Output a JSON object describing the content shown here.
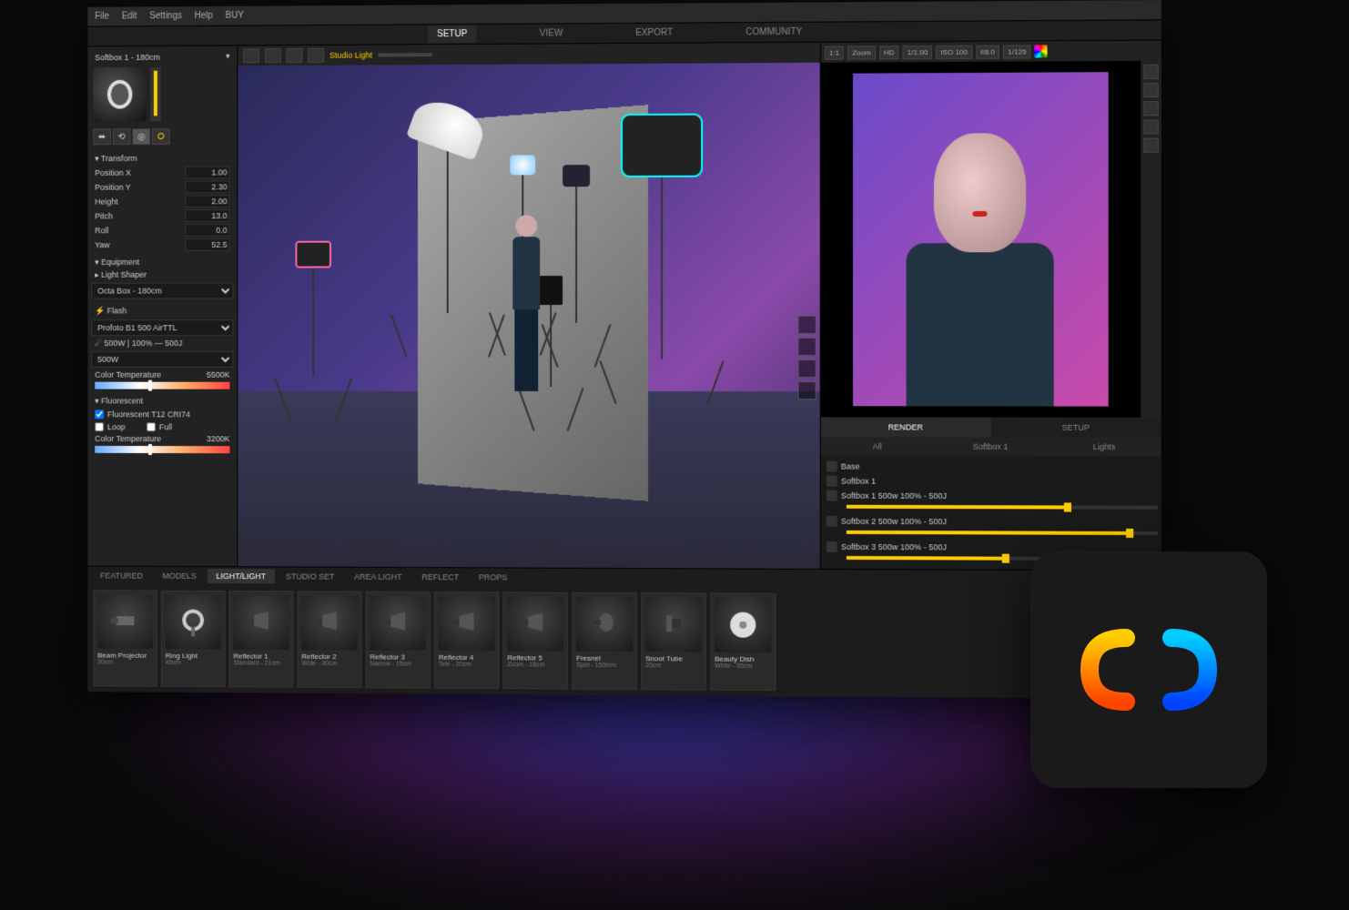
{
  "menu": {
    "items": [
      "File",
      "Edit",
      "Settings",
      "Help",
      "BUY"
    ]
  },
  "main_tabs": {
    "items": [
      "SETUP",
      "VIEW",
      "EXPORT",
      "COMMUNITY"
    ],
    "active": 0
  },
  "left_panel": {
    "header": "Softbox 1 - 180cm",
    "intensity_lock": "⭘",
    "tool_buttons": [
      "⬚",
      "⬚",
      "↺",
      "⟳"
    ],
    "transform_label": "▾ Transform",
    "transform": [
      {
        "label": "Position X",
        "value": "1.00"
      },
      {
        "label": "Position Y",
        "value": "2.30"
      },
      {
        "label": "Height",
        "value": "2.00"
      },
      {
        "label": "Pitch",
        "value": "13.0"
      },
      {
        "label": "Roll",
        "value": "0.0"
      },
      {
        "label": "Yaw",
        "value": "52.5"
      }
    ],
    "equipment_label": "▾ Equipment",
    "light_shaper_label": "▸ Light Shaper",
    "light_shaper_value": "Octa Box - 180cm",
    "flash_label": "⚡ Flash",
    "flash_sub": "Profoto B1 500 AirTTL",
    "power_label": "☄ 500W | 100% — 500J",
    "power_value": "500W",
    "color_temp_label": "Color Temperature",
    "color_temp_value": "5500K",
    "fluorescent_label": "▾ Fluorescent",
    "fluorescent_sub": "Fluorescent T12 CRI74",
    "loop_label": "Loop",
    "full_label": "Full",
    "color_temp2_label": "Color Temperature",
    "color_temp2_value": "3200K"
  },
  "viewport_toolbar": {
    "label": "Studio Light",
    "buttons": [
      "✥",
      "▤",
      "☀",
      "✦"
    ]
  },
  "render_toolbar": {
    "buttons": [
      "1:1",
      "Zoom",
      "HD",
      "1/1.00",
      "ISO 100",
      "f/8.0",
      "1/125"
    ]
  },
  "render_tabs": {
    "items": [
      "RENDER",
      "SETUP"
    ],
    "active": 0
  },
  "render_sub_tabs": {
    "items": [
      "All",
      "Softbox 1",
      "Lights"
    ]
  },
  "layers": [
    {
      "label": "Base",
      "slider": 0
    },
    {
      "label": "Softbox 1",
      "slider": 0
    },
    {
      "label": "Softbox 1 500w 100% - 500J",
      "slider": 70
    },
    {
      "label": "Softbox 2 500w 100% - 500J",
      "slider": 90
    },
    {
      "label": "Softbox 3 500w 100% - 500J",
      "slider": 50
    }
  ],
  "asset_tabs": {
    "items": [
      "FEATURED",
      "MODELS",
      "LIGHT/LIGHT",
      "STUDIO SET",
      "AREA LIGHT",
      "REFLECT",
      "PROPS"
    ],
    "active": 2
  },
  "assets": [
    {
      "name": "Beam Projector",
      "sub": "30cm"
    },
    {
      "name": "Ring Light",
      "sub": "45cm"
    },
    {
      "name": "Reflector 1",
      "sub": "Standard - 21cm"
    },
    {
      "name": "Reflector 2",
      "sub": "Wide - 30cm"
    },
    {
      "name": "Reflector 3",
      "sub": "Narrow - 15cm"
    },
    {
      "name": "Reflector 4",
      "sub": "Tele - 20cm"
    },
    {
      "name": "Reflector 5",
      "sub": "Zoom - 18cm"
    },
    {
      "name": "Fresnel",
      "sub": "Spot - 150mm"
    },
    {
      "name": "Snoot Tube",
      "sub": "20cm"
    },
    {
      "name": "Beauty Dish",
      "sub": "White - 55cm"
    }
  ]
}
